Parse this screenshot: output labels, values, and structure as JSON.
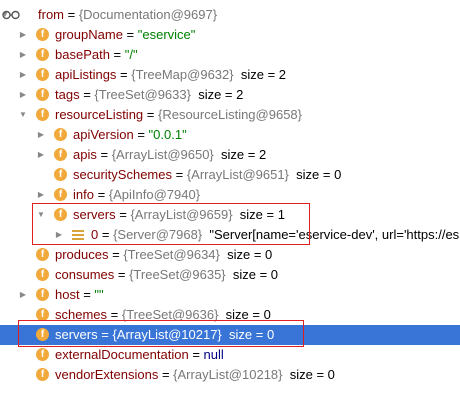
{
  "root": {
    "name": "from",
    "value": "{Documentation@9697}"
  },
  "rows": [
    {
      "name": "groupName",
      "eq": " = ",
      "value": "\"eservice\"",
      "vtype": "str",
      "indent": 1,
      "arrow": "right"
    },
    {
      "name": "basePath",
      "eq": " = ",
      "value": "\"/\"",
      "vtype": "str",
      "indent": 1,
      "arrow": "right"
    },
    {
      "name": "apiListings",
      "eq": " = ",
      "value": "{TreeMap@9632}",
      "vtype": "ref",
      "extra": "size = 2",
      "indent": 1,
      "arrow": "right"
    },
    {
      "name": "tags",
      "eq": " = ",
      "value": "{TreeSet@9633}",
      "vtype": "ref",
      "extra": "size = 2",
      "indent": 1,
      "arrow": "right"
    },
    {
      "name": "resourceListing",
      "eq": " = ",
      "value": "{ResourceListing@9658}",
      "vtype": "ref",
      "indent": 1,
      "arrow": "down"
    },
    {
      "name": "apiVersion",
      "eq": " = ",
      "value": "\"0.0.1\"",
      "vtype": "str",
      "indent": 2,
      "arrow": "right"
    },
    {
      "name": "apis",
      "eq": " = ",
      "value": "{ArrayList@9650}",
      "vtype": "ref",
      "extra": "size = 2",
      "indent": 2,
      "arrow": "right"
    },
    {
      "name": "securitySchemes",
      "eq": " = ",
      "value": "{ArrayList@9651}",
      "vtype": "ref",
      "extra": "size = 0",
      "indent": 2,
      "arrow": "none"
    },
    {
      "name": "info",
      "eq": " = ",
      "value": "{ApiInfo@7940}",
      "vtype": "ref",
      "indent": 2,
      "arrow": "right"
    },
    {
      "name": "servers",
      "eq": " = ",
      "value": "{ArrayList@9659}",
      "vtype": "ref",
      "extra": "size = 1",
      "indent": 2,
      "arrow": "down"
    },
    {
      "name": "0",
      "eq": " = ",
      "value": "{Server@7968}",
      "vtype": "ref",
      "extra": "\"Server[name='eservice-dev', url='https://es",
      "indent": 3,
      "arrow": "right",
      "lines": true
    },
    {
      "name": "produces",
      "eq": " = ",
      "value": "{TreeSet@9634}",
      "vtype": "ref",
      "extra": "size = 0",
      "indent": 1,
      "arrow": "none"
    },
    {
      "name": "consumes",
      "eq": " = ",
      "value": "{TreeSet@9635}",
      "vtype": "ref",
      "extra": "size = 0",
      "indent": 1,
      "arrow": "none"
    },
    {
      "name": "host",
      "eq": " = ",
      "value": "\"\"",
      "vtype": "str",
      "indent": 1,
      "arrow": "right"
    },
    {
      "name": "schemes",
      "eq": " = ",
      "value": "{TreeSet@9636}",
      "vtype": "ref",
      "extra": "size = 0",
      "indent": 1,
      "arrow": "none"
    },
    {
      "name": "servers",
      "eq": " = ",
      "value": "{ArrayList@10217}",
      "vtype": "ref",
      "extra": "size = 0",
      "indent": 1,
      "arrow": "none",
      "selected": true
    },
    {
      "name": "externalDocumentation",
      "eq": " = ",
      "value": "null",
      "vtype": "kw",
      "indent": 1,
      "arrow": "none"
    },
    {
      "name": "vendorExtensions",
      "eq": " = ",
      "value": "{ArrayList@10218}",
      "vtype": "ref",
      "extra": "size = 0",
      "indent": 1,
      "arrow": "none"
    }
  ],
  "icons": {
    "field": "f",
    "watch": "glasses-icon"
  },
  "colors": {
    "selection": "#3875d7",
    "highlight_box": "#e02020",
    "field_badge": "#f2a93b",
    "string": "#008000",
    "field_name": "#800000"
  }
}
